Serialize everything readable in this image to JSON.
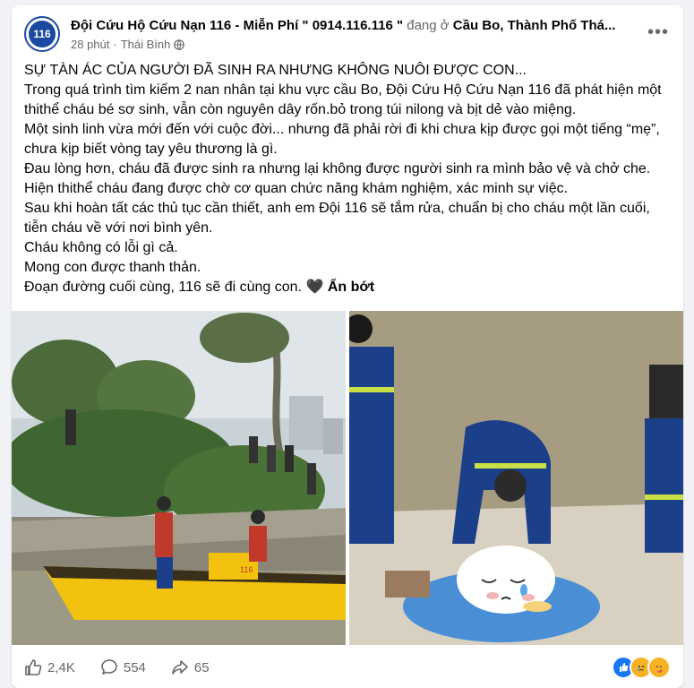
{
  "post": {
    "page_name": "Đội Cứu Hộ Cứu Nạn 116 - Miễn Phí \" 0914.116.116 \"",
    "is_at": "đang ở",
    "location": "Cầu Bo, Thành Phố Thá...",
    "time": "28 phút",
    "separator": "·",
    "place": "Thái Bình",
    "avatar_text": "116",
    "lines": [
      "SỰ TÀN ÁC CỦA NGƯỜI ĐÃ SINH RA NHƯNG KHÔNG NUÔI ĐƯỢC CON...",
      "Trong quá trình tìm kiếm 2 nan nhân tại khu vực cầu Bo, Đội Cứu Hộ Cứu Nạn 116 đã phát hiện một thithể cháu bé sơ sinh, vẫn còn nguyên dây rốn.bỏ trong túi nilong và bịt dẻ vào miệng.",
      "Một sinh linh vừa mới đến với cuộc đời... nhưng đã phải rời đi khi chưa kịp được gọi một tiếng “mẹ”, chưa kịp biết vòng tay yêu thương là gì.",
      "Đau lòng hơn, cháu đã được sinh ra nhưng lại không được người sinh ra mình bảo vệ và chở che.",
      "Hiện thithể cháu đang được chờ cơ quan chức năng khám nghiệm, xác minh sự việc.",
      "Sau khi hoàn tất các thủ tục cần thiết, anh em Đội 116 sẽ tắm rửa, chuẩn bị cho cháu một lần cuối, tiễn cháu về với nơi bình yên.",
      "Cháu không có lỗi gì cả.",
      "Mong con được thanh thản.",
      "Đoạn đường cuối cùng, 116 sẽ đi cùng con. 🖤"
    ],
    "see_less": "Ẩn bớt",
    "boat_label": "116"
  },
  "stats": {
    "likes": "2,4K",
    "comments": "554",
    "shares": "65"
  },
  "icons": [
    "globe-icon",
    "more-icon",
    "like-icon",
    "comment-icon",
    "share-icon",
    "love-reaction-icon",
    "sad-reaction-icon",
    "care-reaction-icon"
  ],
  "colors": {
    "facebook_blue": "#1877f2",
    "secondary_text": "#65676b",
    "rescue_uniform": "#1c3f8a",
    "boat_yellow": "#f2c20f"
  }
}
